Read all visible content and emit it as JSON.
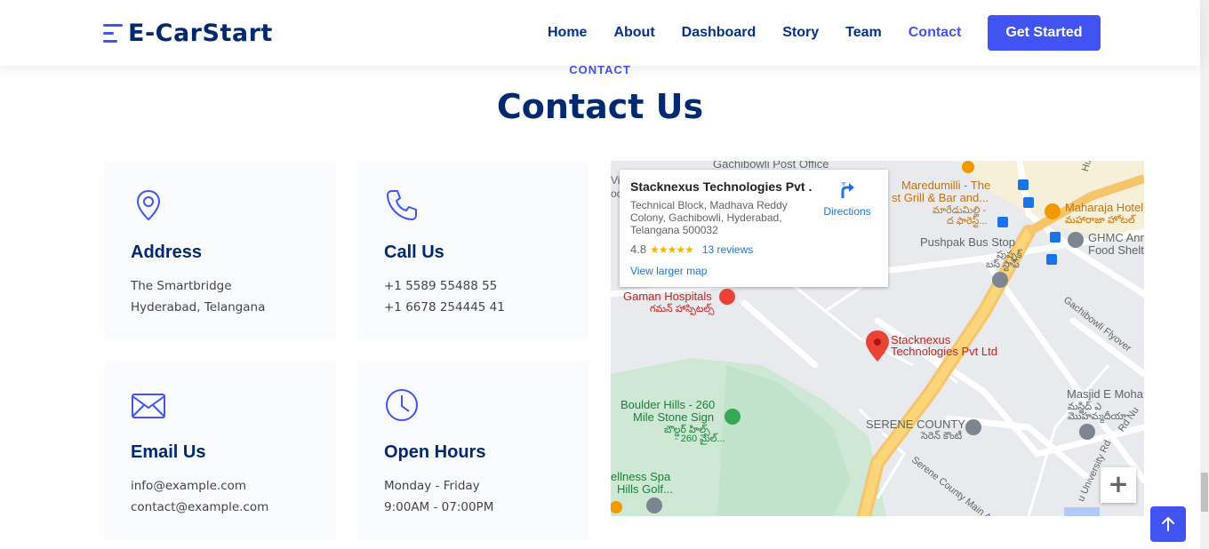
{
  "header": {
    "brand": "E-CarStart",
    "nav": [
      {
        "label": "Home"
      },
      {
        "label": "About"
      },
      {
        "label": "Dashboard"
      },
      {
        "label": "Story"
      },
      {
        "label": "Team"
      },
      {
        "label": "Contact",
        "active": true
      }
    ],
    "cta_label": "Get Started"
  },
  "section": {
    "subtitle": "CONTACT",
    "title": "Contact Us"
  },
  "cards": [
    {
      "icon": "map-pin-icon",
      "title": "Address",
      "lines": [
        "The Smartbridge",
        "Hyderabad, Telangana"
      ]
    },
    {
      "icon": "phone-icon",
      "title": "Call Us",
      "lines": [
        "+1 5589 55488 55",
        "+1 6678 254445 41"
      ]
    },
    {
      "icon": "envelope-icon",
      "title": "Email Us",
      "lines": [
        "info@example.com",
        "contact@example.com"
      ]
    },
    {
      "icon": "clock-icon",
      "title": "Open Hours",
      "lines": [
        "Monday - Friday",
        "9:00AM - 07:00PM"
      ]
    }
  ],
  "map": {
    "place_name": "Stacknexus Technologies Pvt ...",
    "address": "Technical Block, Madhava Reddy Colony, Gachibowli, Hyderabad, Telangana 500032",
    "rating": "4.8",
    "stars": "★★★★★",
    "reviews": "13 reviews",
    "directions_label": "Directions",
    "larger_map": "View larger map",
    "zoom_in": "+",
    "labels": {
      "post_office": "Gachibowli Post Office",
      "maredumilli_1": "Maredumilli - The",
      "maredumilli_2": "st Grill & Bar and...",
      "maredumilli_3": "మారేడుమిల్లి -",
      "maredumilli_4": "ద ఫారెస్ట్...",
      "maharaja_1": "Maharaja Hotel",
      "maharaja_2": "మహారాజా హోటల్",
      "ghmc_1": "GHMC Anna",
      "ghmc_2": "Food Shelt",
      "pushpak_1": "Pushpak Bus Stop",
      "pushpak_2": "పుష్పక్",
      "pushpak_3": "బస్ స్టాప్",
      "flyover": "Gachibowli Flyover",
      "gaman_1": "Gaman Hospitals",
      "gaman_2": "గమన్ హాస్పిటల్స్",
      "pin_1": "Stacknexus",
      "pin_2": "Technologies Pvt Ltd",
      "boulder_1": "Boulder Hills - 260",
      "boulder_2": "Mile Stone Sign",
      "boulder_3": "బౌల్డర్ హిల్స్",
      "boulder_4": "- 260 మైల్...",
      "serene_1": "SERENE COUNTY",
      "serene_2": "సెరెన్ కౌంటీ",
      "serene_road": "Serene County Main Ave",
      "masjid_1": "Masjid E Moha",
      "masjid_2": "మస్జిద్ ఎ",
      "masjid_3": "మొహమ్మదీయా",
      "wellness_1": "ellness Spa",
      "wellness_2": "Hills Golf...",
      "univ_road": "u University Rd",
      "rd_nu": "Rd Nu",
      "vic": "Vic",
      "oc": "oc",
      "hus": "Huss"
    }
  },
  "colors": {
    "accent": "#4154f1",
    "heading": "#012970",
    "card_bg": "#fafbff"
  }
}
